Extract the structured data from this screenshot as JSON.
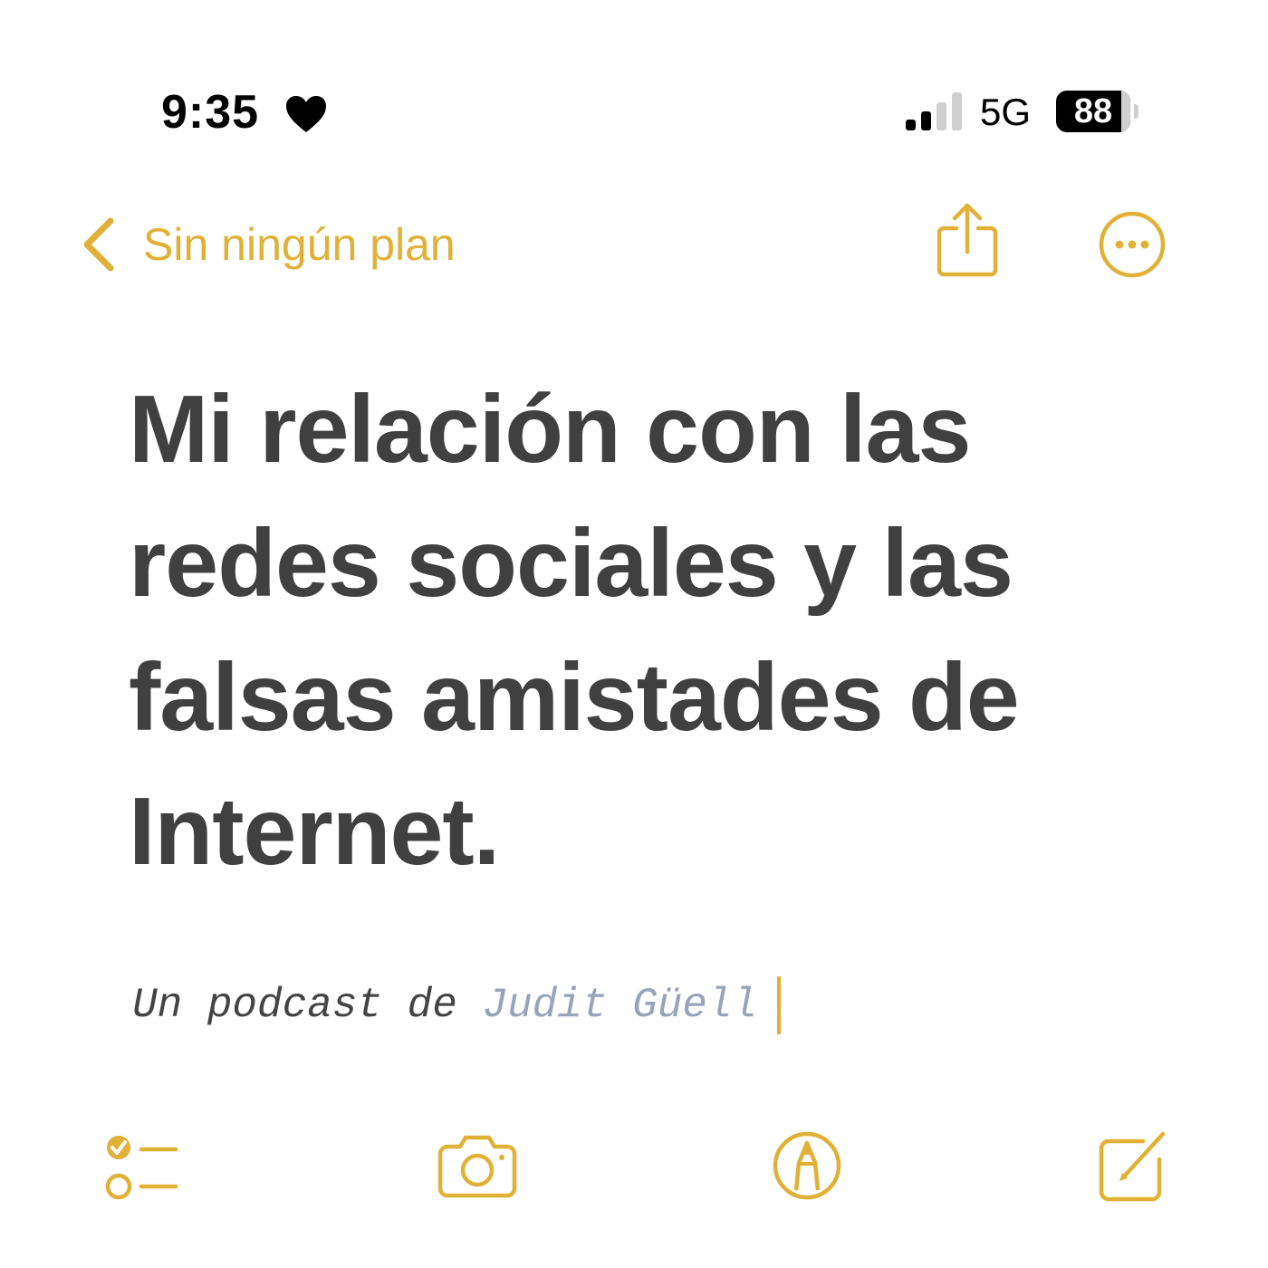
{
  "status_bar": {
    "time": "9:35",
    "focus_icon": "heart-icon",
    "network": "5G",
    "battery_level": "88",
    "signal_bars_active": 2,
    "signal_bars_total": 4
  },
  "nav": {
    "back_label": "Sin ningún plan",
    "back_icon": "chevron-left-icon",
    "share_icon": "share-icon",
    "more_icon": "ellipsis-circle-icon"
  },
  "note": {
    "title_lines": [
      "Mi relación con las",
      "redes sociales y las",
      "falsas amistades de",
      "Internet."
    ],
    "subtitle_prefix": "Un podcast de ",
    "subtitle_author": "Judit Güell"
  },
  "toolbar": {
    "checklist_icon": "checklist-icon",
    "camera_icon": "camera-icon",
    "markup_icon": "markup-pen-icon",
    "compose_icon": "compose-icon"
  },
  "colors": {
    "accent": "#e0b136",
    "title_text": "#404040",
    "subtitle_text": "#444444",
    "author_text": "#97a3b8",
    "background": "#ffffff"
  }
}
